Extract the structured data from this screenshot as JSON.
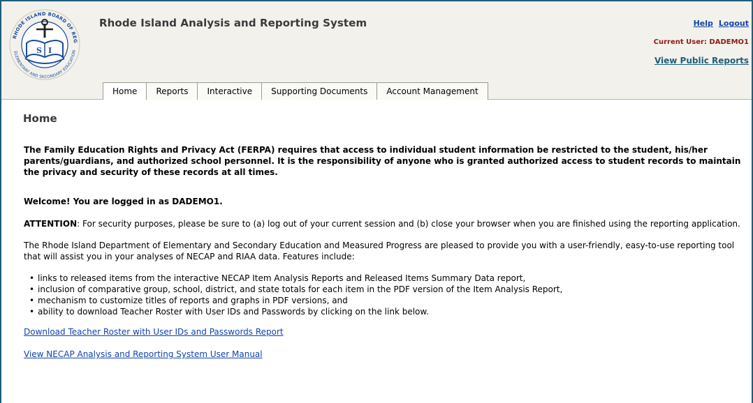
{
  "logo": {
    "seal_text_top": "RHODE ISLAND BOARD OF REGENTS",
    "seal_text_bottom": "ELEMENTARY AND SECONDARY EDUCATION",
    "seal_center": "S I"
  },
  "header": {
    "title": "Rhode Island Analysis and Reporting System",
    "help_label": "Help",
    "logout_label": "Logout",
    "current_user": "Current User: DADEMO1",
    "public_reports_label": "View Public Reports"
  },
  "tabs": [
    {
      "label": "Home"
    },
    {
      "label": "Reports"
    },
    {
      "label": "Interactive"
    },
    {
      "label": "Supporting Documents"
    },
    {
      "label": "Account Management"
    }
  ],
  "main": {
    "page_title": "Home",
    "ferpa_notice": "The Family Education Rights and Privacy Act (FERPA) requires that access to individual student information be restricted to the student, his/her parents/guardians, and authorized school personnel. It is the responsibility of anyone who is granted authorized access to student records to maintain the privacy and security of these records at all times.",
    "welcome": "Welcome! You are logged in as DADEMO1.",
    "attention_label": "ATTENTION",
    "attention_text": ": For security purposes, please be sure to (a) log out of your current session and (b) close your browser when you are finished using the reporting application.",
    "intro": "The Rhode Island Department of Elementary and Secondary Education and Measured Progress are pleased to provide you with a user-friendly, easy-to-use reporting tool that will assist you in your analyses of NECAP and RIAA data. Features include:",
    "features": [
      "links to released items from the interactive NECAP Item Analysis Reports and Released Items Summary Data report,",
      "inclusion of comparative group, school, district, and state totals for each item in the PDF version of the Item Analysis Report,",
      "mechanism to customize titles of reports and graphs in PDF versions, and",
      "ability to download Teacher Roster with User IDs and Passwords by clicking on the link below."
    ],
    "link_roster": "Download Teacher Roster with User IDs and Passwords Report",
    "link_manual": "View NECAP Analysis and Reporting System User Manual"
  },
  "colors": {
    "frame_border": "#1f5e7a",
    "header_bg": "#f2f1ec",
    "link": "#1144aa",
    "current_user": "#8b1a1a"
  }
}
